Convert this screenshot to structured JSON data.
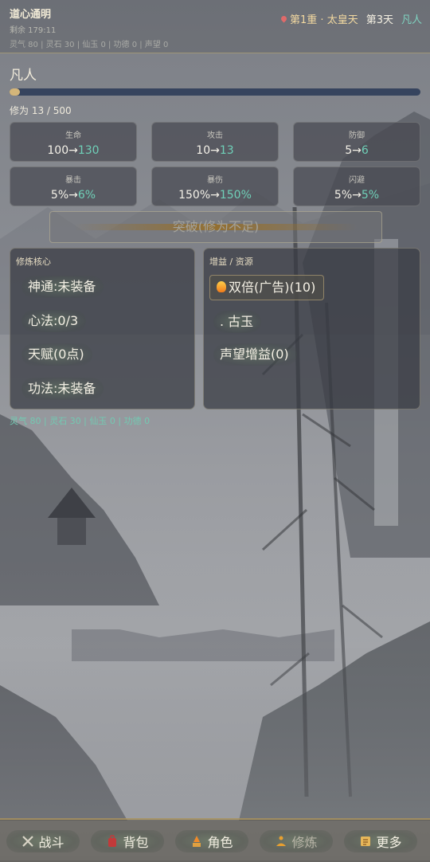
{
  "header": {
    "title": "道心通明",
    "remaining": "剩余 179:11",
    "resources": "灵气 80 | 灵石 30 | 仙玉 0 | 功德 0 | 声望 0",
    "location": "第1重 · 太皇天",
    "day": "第3天",
    "realm_tag": "凡人"
  },
  "realm": {
    "name": "凡人",
    "progress": 0.026,
    "xiuwei_text": "修为 13 / 500"
  },
  "stats": [
    {
      "name": "生命",
      "from": "100",
      "to": "130"
    },
    {
      "name": "攻击",
      "from": "10",
      "to": "13"
    },
    {
      "name": "防御",
      "from": "5",
      "to": "6"
    },
    {
      "name": "暴击",
      "from": "5%",
      "to": "6%"
    },
    {
      "name": "暴伤",
      "from": "150%",
      "to": "150%"
    },
    {
      "name": "闪避",
      "from": "5%",
      "to": "5%"
    }
  ],
  "arrow": "→",
  "breakthrough_label": "突破(修为不足)",
  "core_panel": {
    "title": "修炼核心",
    "items": [
      "神通:未装备",
      "心法:0/3",
      "天赋(0点)",
      "功法:未装备"
    ]
  },
  "buff_panel": {
    "title": "增益 / 资源",
    "double_label": "双倍(广告)(10)",
    "guyu_label": ". 古玉",
    "reputation_label": "声望增益(0)"
  },
  "resources_line": "灵气 80 | 灵石 30 | 仙玉 0 | 功德 0",
  "bottom_nav": [
    {
      "label": "战斗",
      "icon": "crossed-swords-icon"
    },
    {
      "label": "背包",
      "icon": "backpack-icon"
    },
    {
      "label": "角色",
      "icon": "character-icon"
    },
    {
      "label": "修炼",
      "icon": "meditation-icon"
    },
    {
      "label": "更多",
      "icon": "scroll-icon"
    }
  ],
  "colors": {
    "accent_teal": "#6fd0b8",
    "gold": "#d4b67a",
    "bar_track": "#36445e"
  }
}
